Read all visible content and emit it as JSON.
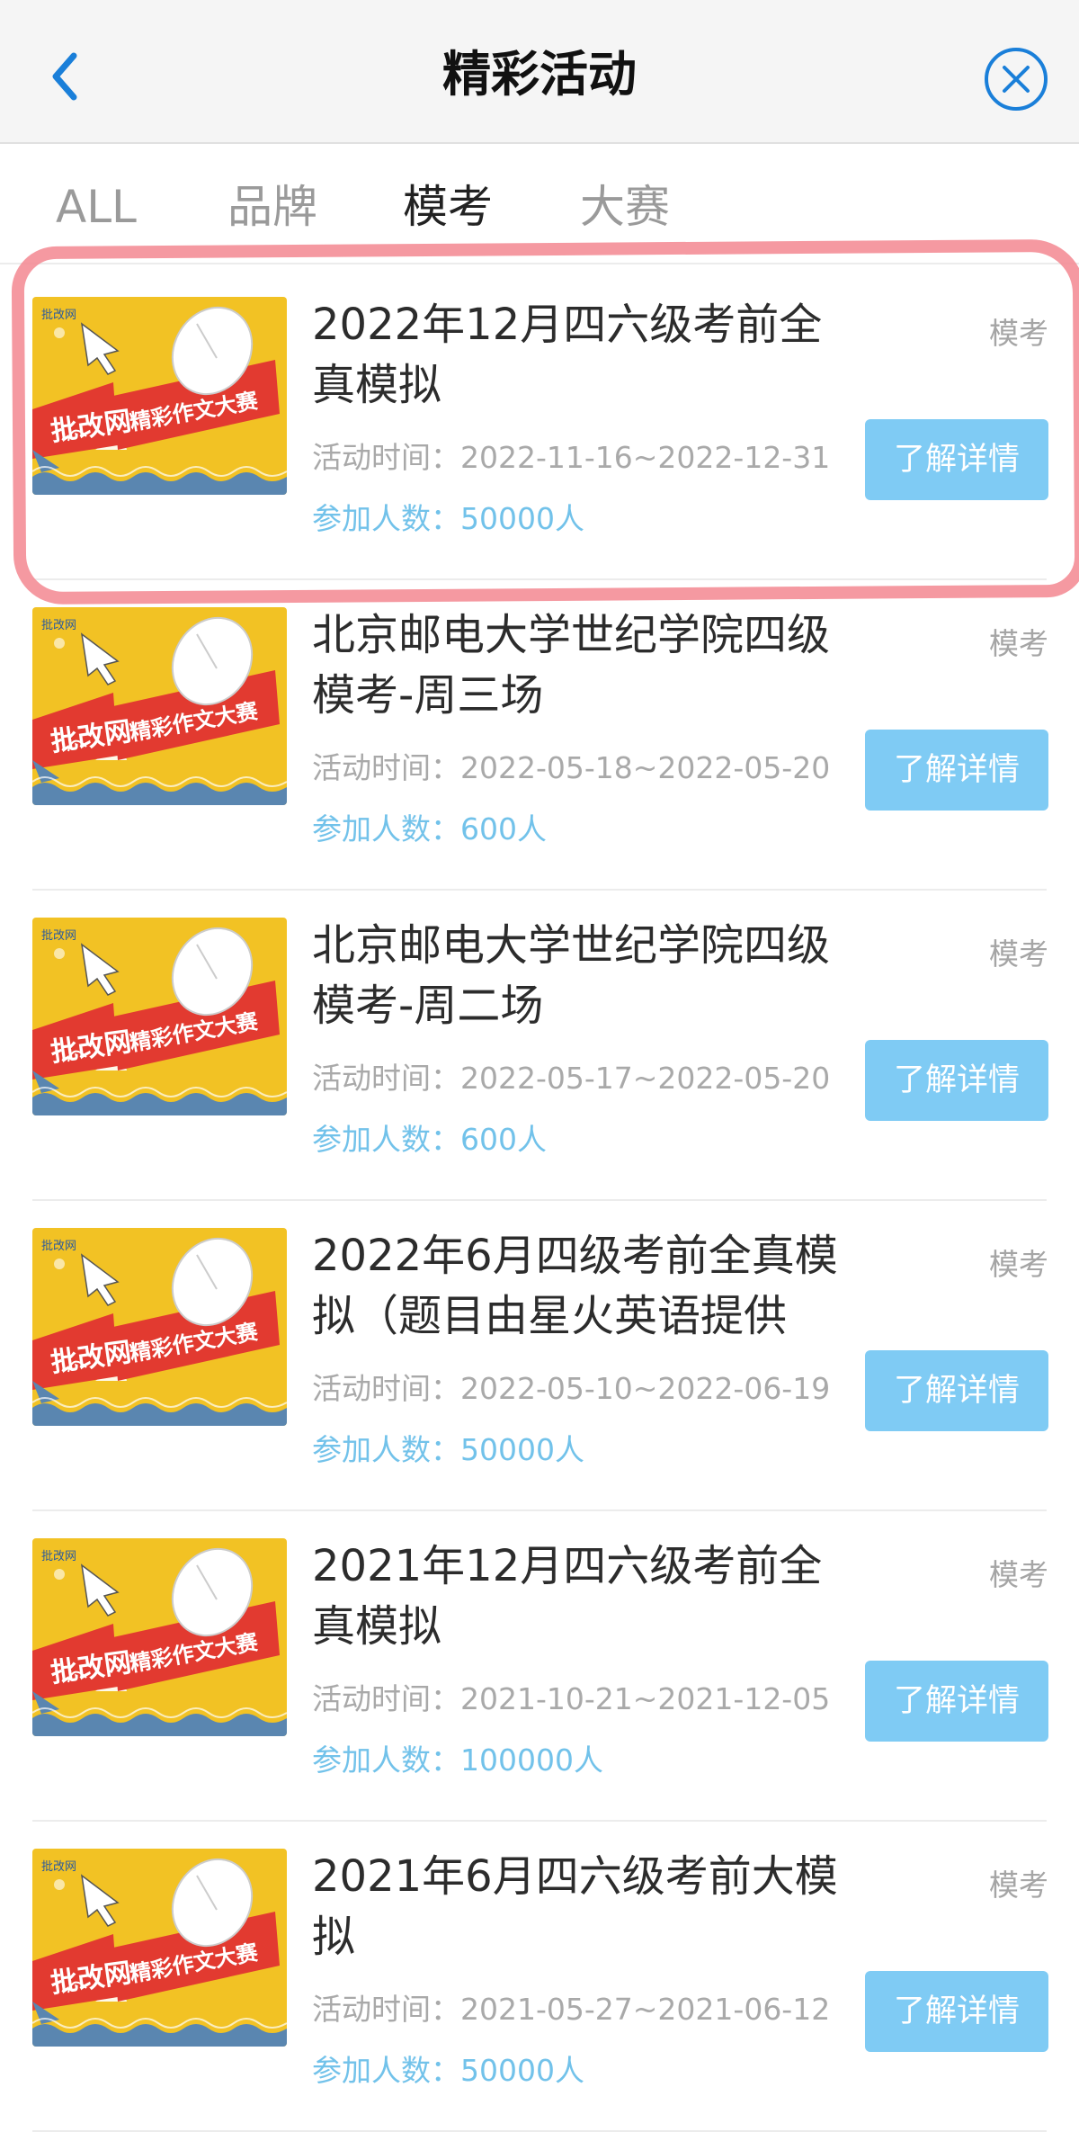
{
  "header": {
    "title": "精彩活动",
    "back_icon": "chevron-left-icon",
    "close_icon": "close-circle-icon",
    "accent_color": "#1a7fd9"
  },
  "tabs": [
    {
      "label": "ALL",
      "active": false
    },
    {
      "label": "品牌",
      "active": false
    },
    {
      "label": "模考",
      "active": true
    },
    {
      "label": "大赛",
      "active": false
    }
  ],
  "activities": [
    {
      "title": "2022年12月四六级考前全真模拟",
      "tag": "模考",
      "time": "活动时间：2022-11-16~2022-12-31",
      "count": "参加人数：50000人",
      "button": "了解详情"
    },
    {
      "title": "北京邮电大学世纪学院四级模考-周三场",
      "tag": "模考",
      "time": "活动时间：2022-05-18~2022-05-20",
      "count": "参加人数：600人",
      "button": "了解详情"
    },
    {
      "title": "北京邮电大学世纪学院四级模考-周二场",
      "tag": "模考",
      "time": "活动时间：2022-05-17~2022-05-20",
      "count": "参加人数：600人",
      "button": "了解详情"
    },
    {
      "title": "2022年6月四级考前全真模拟（题目由星火英语提供",
      "tag": "模考",
      "time": "活动时间：2022-05-10~2022-06-19",
      "count": "参加人数：50000人",
      "button": "了解详情"
    },
    {
      "title": "2021年12月四六级考前全真模拟",
      "tag": "模考",
      "time": "活动时间：2021-10-21~2021-12-05",
      "count": "参加人数：100000人",
      "button": "了解详情"
    },
    {
      "title": "2021年6月四六级考前大模拟",
      "tag": "模考",
      "time": "活动时间：2021-05-27~2021-06-12",
      "count": "参加人数：50000人",
      "button": "了解详情"
    }
  ],
  "thumbnail": {
    "brand_small": "批改网",
    "brand": "批改网",
    "slogan": "精彩作文大赛",
    "colors": {
      "background": "#f2c224",
      "ribbon": "#e23a30",
      "wave": "#5a86b0"
    }
  },
  "colors": {
    "button": "#7fcbf4",
    "count_text": "#72c2ea",
    "highlight": "#f48b94"
  }
}
